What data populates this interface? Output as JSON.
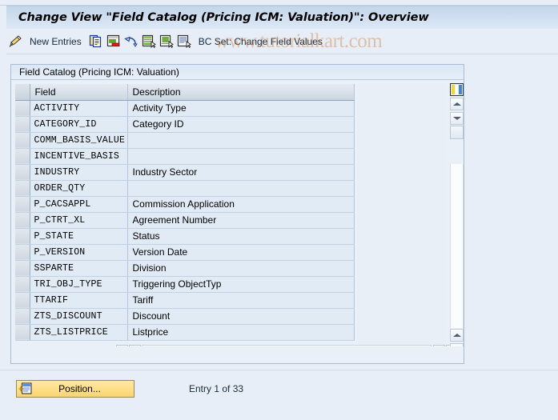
{
  "window": {
    "title": "Change View \"Field Catalog (Pricing ICM: Valuation)\": Overview"
  },
  "watermark": {
    "text": "www.tutorialkart.com",
    "color": "#c8823f"
  },
  "toolbar": {
    "new_entries_label": "New Entries",
    "bc_set_label": "BC Set: Change Field Values",
    "icons": [
      {
        "name": "pencil-icon",
        "title": "Display/Change"
      },
      {
        "name": "copy-icon",
        "title": "Copy As..."
      },
      {
        "name": "delete-icon",
        "title": "Delete"
      },
      {
        "name": "undo-icon",
        "title": "Undo Change"
      },
      {
        "name": "select-all-icon",
        "title": "Select All"
      },
      {
        "name": "deselect-all-icon",
        "title": "Deselect All"
      },
      {
        "name": "details-icon",
        "title": "Details"
      }
    ]
  },
  "panel": {
    "title": "Field Catalog (Pricing ICM: Valuation)"
  },
  "table": {
    "columns": [
      "Field",
      "Description"
    ],
    "rows": [
      {
        "field": "ACTIVITY",
        "description": "Activity Type"
      },
      {
        "field": "CATEGORY_ID",
        "description": "Category ID"
      },
      {
        "field": "COMM_BASIS_VALUE",
        "description": ""
      },
      {
        "field": "INCENTIVE_BASIS",
        "description": ""
      },
      {
        "field": "INDUSTRY",
        "description": "Industry Sector"
      },
      {
        "field": "ORDER_QTY",
        "description": ""
      },
      {
        "field": "P_CACSAPPL",
        "description": "Commission Application"
      },
      {
        "field": "P_CTRT_XL",
        "description": "Agreement Number"
      },
      {
        "field": "P_STATE",
        "description": "Status"
      },
      {
        "field": "P_VERSION",
        "description": "Version Date"
      },
      {
        "field": "SSPARTE",
        "description": "Division"
      },
      {
        "field": "TRI_OBJ_TYPE",
        "description": "Triggering ObjectTyp"
      },
      {
        "field": "TTARIF",
        "description": "Tariff"
      },
      {
        "field": "ZTS_DISCOUNT",
        "description": "Discount"
      },
      {
        "field": "ZTS_LISTPRICE",
        "description": "Listprice"
      }
    ]
  },
  "scrollbars": {
    "horizontal": {
      "left_arrow": "◀",
      "right_arrow": "▶"
    },
    "vertical": {
      "up_arrow": "▲",
      "down_arrow": "▼"
    },
    "column_config_icon": "columns-config-icon"
  },
  "footer": {
    "position_button_label": "Position...",
    "position_icon": "position-icon",
    "entry_status": "Entry 1 of 33"
  }
}
